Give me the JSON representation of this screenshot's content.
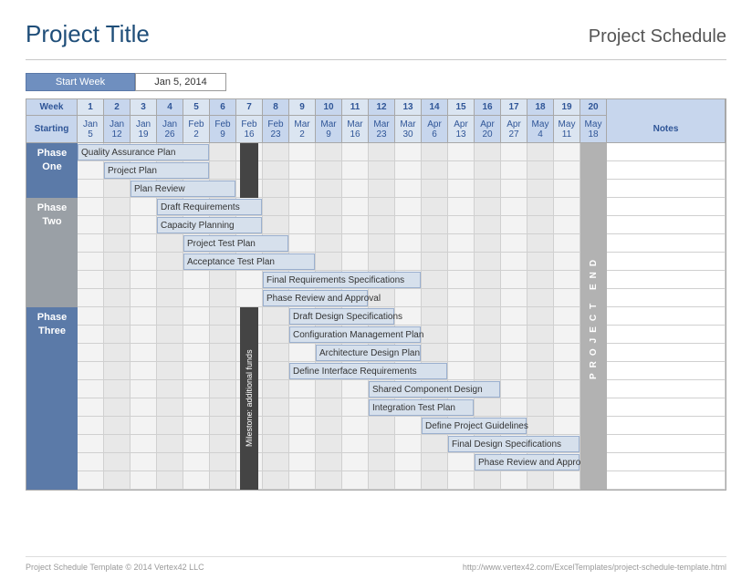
{
  "header": {
    "project_title": "Project Title",
    "schedule_title": "Project Schedule"
  },
  "start": {
    "label": "Start Week",
    "date": "Jan 5, 2014"
  },
  "grid": {
    "week_label": "Week",
    "starting_label": "Starting",
    "notes_label": "Notes",
    "end_label": "PROJECT END",
    "weeks": [
      {
        "n": "1",
        "m": "Jan",
        "d": "5"
      },
      {
        "n": "2",
        "m": "Jan",
        "d": "12"
      },
      {
        "n": "3",
        "m": "Jan",
        "d": "19"
      },
      {
        "n": "4",
        "m": "Jan",
        "d": "26"
      },
      {
        "n": "5",
        "m": "Feb",
        "d": "2"
      },
      {
        "n": "6",
        "m": "Feb",
        "d": "9"
      },
      {
        "n": "7",
        "m": "Feb",
        "d": "16"
      },
      {
        "n": "8",
        "m": "Feb",
        "d": "23"
      },
      {
        "n": "9",
        "m": "Mar",
        "d": "2"
      },
      {
        "n": "10",
        "m": "Mar",
        "d": "9"
      },
      {
        "n": "11",
        "m": "Mar",
        "d": "16"
      },
      {
        "n": "12",
        "m": "Mar",
        "d": "23"
      },
      {
        "n": "13",
        "m": "Mar",
        "d": "30"
      },
      {
        "n": "14",
        "m": "Apr",
        "d": "6"
      },
      {
        "n": "15",
        "m": "Apr",
        "d": "13"
      },
      {
        "n": "16",
        "m": "Apr",
        "d": "20"
      },
      {
        "n": "17",
        "m": "Apr",
        "d": "27"
      },
      {
        "n": "18",
        "m": "May",
        "d": "4"
      },
      {
        "n": "19",
        "m": "May",
        "d": "11"
      },
      {
        "n": "20",
        "m": "May",
        "d": "18"
      }
    ]
  },
  "milestone_label": "Milestone: additional funds",
  "phases": [
    {
      "name": "Phase One",
      "class": "one",
      "start_row": 0,
      "rows": 3
    },
    {
      "name": "Phase Two",
      "class": "two",
      "start_row": 3,
      "rows": 6
    },
    {
      "name": "Phase Three",
      "class": "three",
      "start_row": 9,
      "rows": 10
    }
  ],
  "tasks": [
    {
      "row": 0,
      "start": 1,
      "span": 5,
      "label": "Quality Assurance Plan"
    },
    {
      "row": 1,
      "start": 2,
      "span": 4,
      "label": "Project Plan"
    },
    {
      "row": 2,
      "start": 3,
      "span": 4,
      "label": "Plan Review"
    },
    {
      "row": 3,
      "start": 4,
      "span": 4,
      "label": "Draft Requirements"
    },
    {
      "row": 4,
      "start": 4,
      "span": 4,
      "label": "Capacity Planning"
    },
    {
      "row": 5,
      "start": 5,
      "span": 4,
      "label": "Project Test Plan"
    },
    {
      "row": 6,
      "start": 5,
      "span": 5,
      "label": "Acceptance Test Plan"
    },
    {
      "row": 7,
      "start": 8,
      "span": 6,
      "label": "Final Requirements Specifications"
    },
    {
      "row": 8,
      "start": 8,
      "span": 4,
      "label": "Phase Review and Approval"
    },
    {
      "row": 9,
      "start": 9,
      "span": 4,
      "label": "Draft Design Specifications"
    },
    {
      "row": 10,
      "start": 9,
      "span": 5,
      "label": "Configuration Management Plan"
    },
    {
      "row": 11,
      "start": 10,
      "span": 4,
      "label": "Architecture Design Plan"
    },
    {
      "row": 12,
      "start": 9,
      "span": 6,
      "label": "Define Interface Requirements"
    },
    {
      "row": 13,
      "start": 12,
      "span": 5,
      "label": "Shared Component Design"
    },
    {
      "row": 14,
      "start": 12,
      "span": 4,
      "label": "Integration Test Plan"
    },
    {
      "row": 15,
      "start": 14,
      "span": 4,
      "label": "Define Project Guidelines"
    },
    {
      "row": 16,
      "start": 15,
      "span": 5,
      "label": "Final Design Specifications"
    },
    {
      "row": 17,
      "start": 16,
      "span": 4,
      "label": "Phase Review and Approval"
    }
  ],
  "chart_data": {
    "type": "gantt",
    "title": "Project Schedule",
    "x_unit": "week",
    "x_start_date": "2014-01-05",
    "x_range": [
      1,
      20
    ],
    "notes_column": true,
    "phases": [
      {
        "name": "Phase One",
        "rows": [
          0,
          1,
          2
        ],
        "color": "#5b7aa8"
      },
      {
        "name": "Phase Two",
        "rows": [
          3,
          4,
          5,
          6,
          7,
          8
        ],
        "color": "#9aa0a6"
      },
      {
        "name": "Phase Three",
        "rows": [
          9,
          10,
          11,
          12,
          13,
          14,
          15,
          16,
          17,
          18
        ],
        "color": "#5b7aa8"
      }
    ],
    "tasks": [
      {
        "row": 0,
        "start_week": 1,
        "duration_weeks": 5,
        "label": "Quality Assurance Plan"
      },
      {
        "row": 1,
        "start_week": 2,
        "duration_weeks": 4,
        "label": "Project Plan"
      },
      {
        "row": 2,
        "start_week": 3,
        "duration_weeks": 4,
        "label": "Plan Review"
      },
      {
        "row": 3,
        "start_week": 4,
        "duration_weeks": 4,
        "label": "Draft Requirements"
      },
      {
        "row": 4,
        "start_week": 4,
        "duration_weeks": 4,
        "label": "Capacity Planning"
      },
      {
        "row": 5,
        "start_week": 5,
        "duration_weeks": 4,
        "label": "Project Test Plan"
      },
      {
        "row": 6,
        "start_week": 5,
        "duration_weeks": 5,
        "label": "Acceptance Test Plan"
      },
      {
        "row": 7,
        "start_week": 8,
        "duration_weeks": 6,
        "label": "Final Requirements Specifications"
      },
      {
        "row": 8,
        "start_week": 8,
        "duration_weeks": 4,
        "label": "Phase Review and Approval"
      },
      {
        "row": 9,
        "start_week": 9,
        "duration_weeks": 4,
        "label": "Draft Design Specifications"
      },
      {
        "row": 10,
        "start_week": 9,
        "duration_weeks": 5,
        "label": "Configuration Management Plan"
      },
      {
        "row": 11,
        "start_week": 10,
        "duration_weeks": 4,
        "label": "Architecture Design Plan"
      },
      {
        "row": 12,
        "start_week": 9,
        "duration_weeks": 6,
        "label": "Define Interface Requirements"
      },
      {
        "row": 13,
        "start_week": 12,
        "duration_weeks": 5,
        "label": "Shared Component Design"
      },
      {
        "row": 14,
        "start_week": 12,
        "duration_weeks": 4,
        "label": "Integration Test Plan"
      },
      {
        "row": 15,
        "start_week": 14,
        "duration_weeks": 4,
        "label": "Define Project Guidelines"
      },
      {
        "row": 16,
        "start_week": 15,
        "duration_weeks": 5,
        "label": "Final Design Specifications"
      },
      {
        "row": 17,
        "start_week": 16,
        "duration_weeks": 4,
        "label": "Phase Review and Approval"
      }
    ],
    "milestones": [
      {
        "week": 7,
        "label": "Milestone: additional funds"
      },
      {
        "week": 20,
        "label": "PROJECT END"
      }
    ]
  },
  "footer": {
    "left": "Project Schedule Template © 2014 Vertex42 LLC",
    "right": "http://www.vertex42.com/ExcelTemplates/project-schedule-template.html"
  }
}
